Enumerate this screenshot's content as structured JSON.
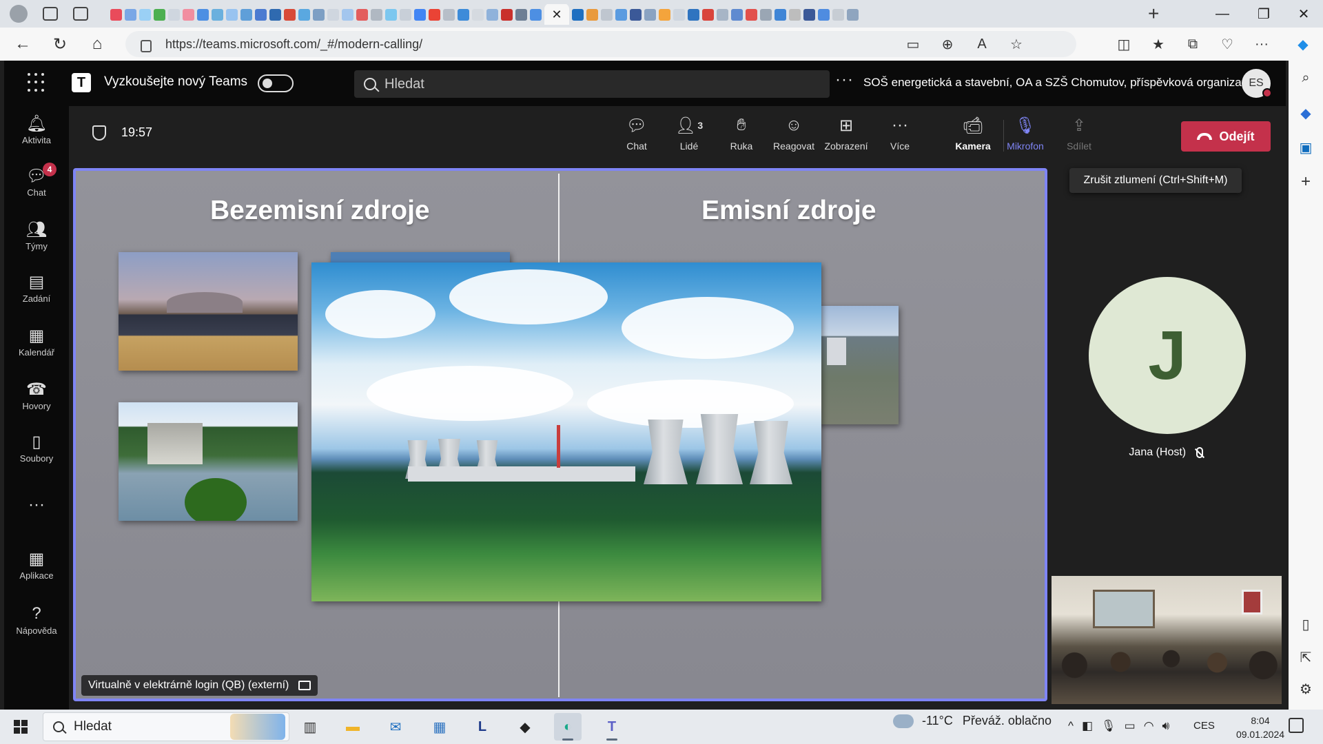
{
  "browser": {
    "url": "https://teams.microsoft.com/_#/modern-calling/",
    "tab_close": "✕",
    "new_tab": "+",
    "window_controls": {
      "minimize": "—",
      "maximize": "❐",
      "close": "✕"
    },
    "icons": [
      "back-icon",
      "refresh-icon",
      "home-icon",
      "lock-icon",
      "camera-icon",
      "zoom-icon",
      "read-aloud-icon",
      "favorite-icon",
      "split-screen-icon",
      "favorites-icon",
      "collections-icon",
      "browser-essentials-icon",
      "more-icon",
      "copilot-icon"
    ],
    "tab_favicon_colors": [
      "#e94b5b",
      "#7aa7e6",
      "#9ad0f5",
      "#4caf50",
      "#cfd6df",
      "#f18ea0",
      "#4d8fe3",
      "#6ab0de",
      "#98c3f0",
      "#5f9fd9",
      "#4b7bd1",
      "#2f6ab0",
      "#d84a38",
      "#5aa8e0",
      "#7d9fc4",
      "#cfd6df",
      "#a3c6ee",
      "#e35d5d",
      "#b0b8c2",
      "#7cc7ef",
      "#c8cfd8",
      "#4285f4",
      "#ea4335",
      "#b7bec8",
      "#3d8bd9",
      "#d5dae0",
      "#8fb2db",
      "#c9302c",
      "#6e7f95",
      "#4d8fe3",
      "#1f6fc0",
      "#e99a3d",
      "#bfc6cf",
      "#5a9be0",
      "#3b5998",
      "#8aa3c2",
      "#f4a43c",
      "#cfd6df",
      "#2f74c0",
      "#d9443b",
      "#a7b5c6",
      "#5f8ad0",
      "#e2504c",
      "#9aa6b4",
      "#3f85d6",
      "#bdbdbd",
      "#3b5998",
      "#4f8ce0",
      "#c7cdd4",
      "#8fa5bf"
    ]
  },
  "edge_sidebar": {
    "icons": [
      "search-icon",
      "copilot-icon",
      "outlook-icon",
      "add-icon",
      "split-icon",
      "external-icon",
      "settings-icon"
    ],
    "glyphs": {
      "search": "⌕",
      "copilot": "◆",
      "outlook": "▣",
      "add": "+",
      "split": "▯",
      "external": "⇱",
      "settings": "⚙"
    }
  },
  "teams": {
    "header": {
      "app_name": "Vyzkoušejte nový Teams",
      "logo": "T",
      "search_placeholder": "Hledat",
      "more": "···",
      "org": "SOŠ energetická a stavební, OA a SZŠ Chomutov, příspěvková organizace",
      "avatar_initials": "ES"
    },
    "rail": [
      {
        "label": "Aktivita",
        "icon": "bell-icon",
        "glyph": "🔔︎"
      },
      {
        "label": "Chat",
        "icon": "chat-icon",
        "glyph": "💬︎",
        "badge": "4"
      },
      {
        "label": "Týmy",
        "icon": "teams-icon",
        "glyph": "👥︎"
      },
      {
        "label": "Zadání",
        "icon": "assignments-icon",
        "glyph": "▤"
      },
      {
        "label": "Kalendář",
        "icon": "calendar-icon",
        "glyph": "▦"
      },
      {
        "label": "Hovory",
        "icon": "phone-icon",
        "glyph": "☎"
      },
      {
        "label": "Soubory",
        "icon": "file-icon",
        "glyph": "▯"
      },
      {
        "label": "",
        "icon": "more-icon",
        "glyph": "···"
      },
      {
        "label": "Aplikace",
        "icon": "apps-icon",
        "glyph": "▦"
      },
      {
        "label": "Nápověda",
        "icon": "help-icon",
        "glyph": "?"
      }
    ],
    "meeting": {
      "timer": "19:57",
      "controls": [
        {
          "label": "Chat",
          "icon": "chat-icon",
          "glyph": "💬︎"
        },
        {
          "label": "Lidé",
          "icon": "people-icon",
          "glyph": "👤︎",
          "count": "3"
        },
        {
          "label": "Ruka",
          "icon": "raise-hand-icon",
          "glyph": "✋︎"
        },
        {
          "label": "Reagovat",
          "icon": "react-icon",
          "glyph": "☺"
        },
        {
          "label": "Zobrazení",
          "icon": "view-icon",
          "glyph": "⊞"
        },
        {
          "label": "Více",
          "icon": "more-icon",
          "glyph": "···"
        },
        {
          "label": "Kamera",
          "icon": "camera-icon",
          "glyph": "📹︎"
        },
        {
          "label": "Mikrofon",
          "icon": "mic-off-icon",
          "glyph": "🎙︎"
        },
        {
          "label": "Sdílet",
          "icon": "share-icon",
          "glyph": "⇪"
        }
      ],
      "leave_label": "Odejít",
      "tooltip": "Zrušit ztlumení (Ctrl+Shift+M)"
    },
    "presentation": {
      "left_title": "Bezemisní zdroje",
      "right_title": "Emisní zdroje",
      "presenter": "Virtualně v elektrárně login (QB) (externí)"
    },
    "participant": {
      "initial": "J",
      "name": "Jana (Host)"
    }
  },
  "taskbar": {
    "search_placeholder": "Hledat",
    "apps": [
      {
        "name": "task-view",
        "glyph": "▥",
        "color": "#333333"
      },
      {
        "name": "file-explorer",
        "glyph": "▬",
        "color": "#f0b429"
      },
      {
        "name": "mail",
        "glyph": "✉",
        "color": "#1f6fc0"
      },
      {
        "name": "store",
        "glyph": "▦",
        "color": "#2f74c0"
      },
      {
        "name": "l-app",
        "glyph": "L",
        "color": "#1e3a8a"
      },
      {
        "name": "dark-app",
        "glyph": "◆",
        "color": "#222222"
      },
      {
        "name": "edge",
        "glyph": "◐",
        "color": "#1aa98a"
      },
      {
        "name": "teams",
        "glyph": "T",
        "color": "#5b5fc7"
      }
    ],
    "weather": {
      "temp": "-11°C",
      "desc": "Převáž. oblačno"
    },
    "tray_glyphs": [
      "^",
      "◧",
      "🎙︎",
      "▭",
      "◠",
      "🔊︎"
    ],
    "lang": "CES",
    "time": "8:04",
    "date": "09.01.2024"
  }
}
